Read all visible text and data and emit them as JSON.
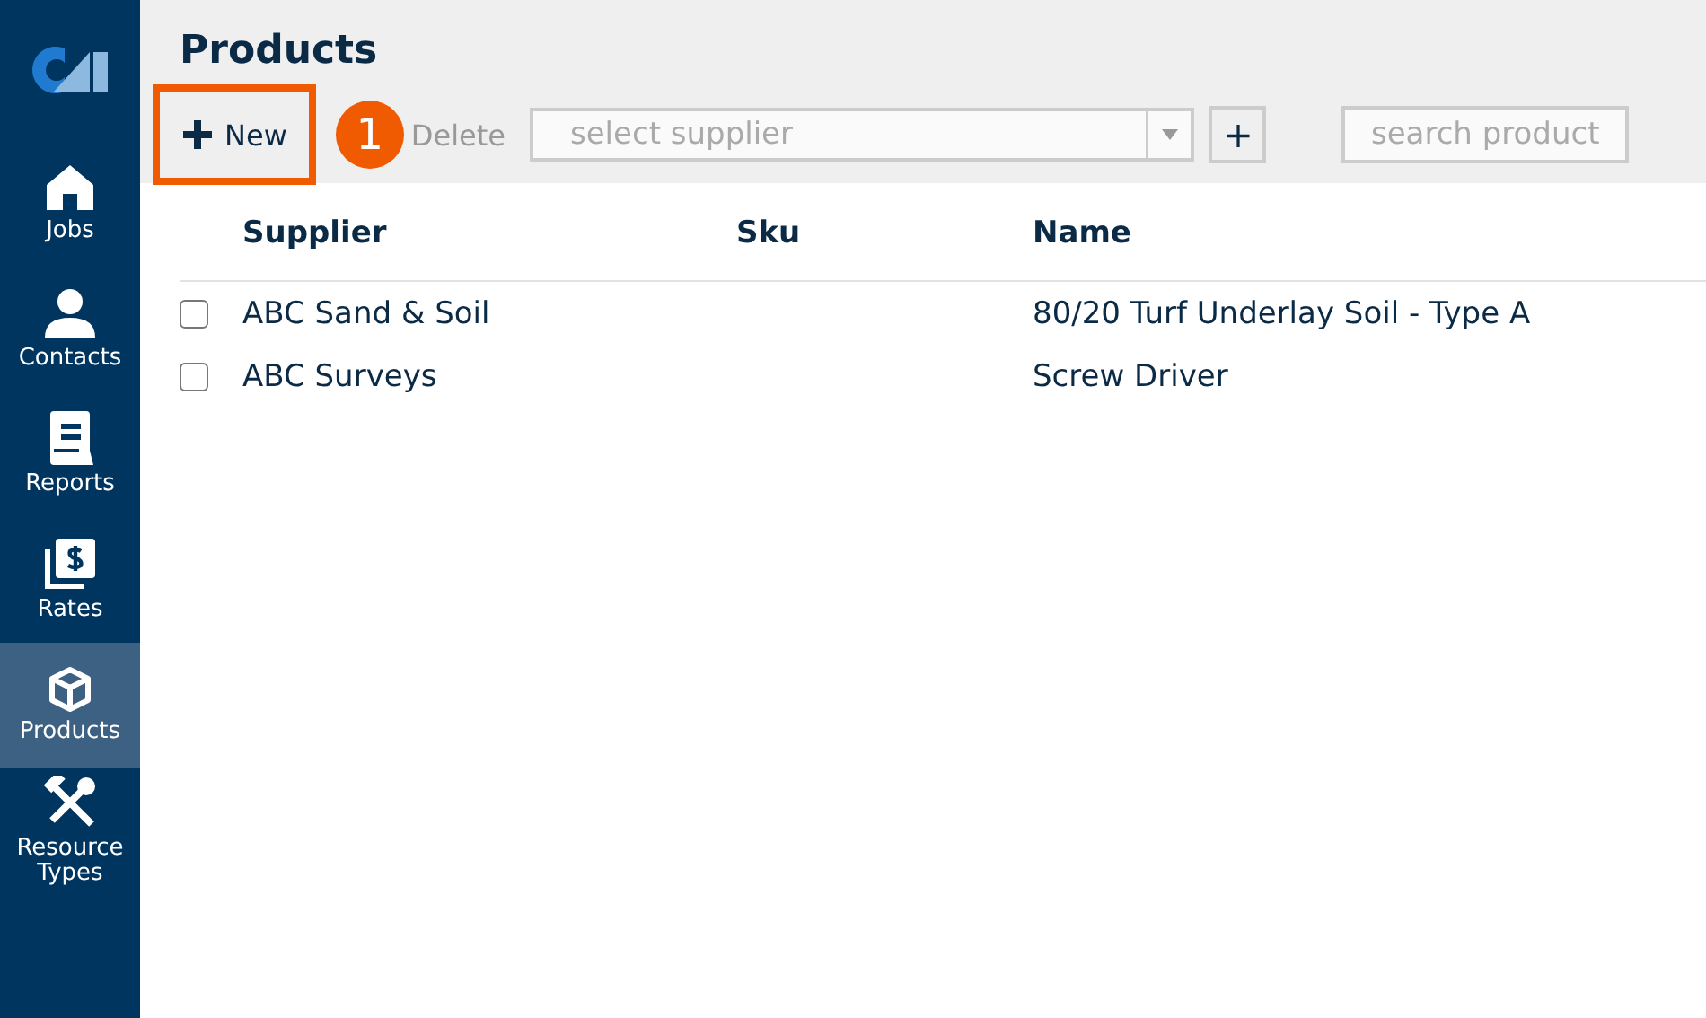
{
  "sidebar": {
    "items": [
      {
        "label": "Jobs",
        "selected": false
      },
      {
        "label": "Contacts",
        "selected": false
      },
      {
        "label": "Reports",
        "selected": false
      },
      {
        "label": "Rates",
        "selected": false
      },
      {
        "label": "Products",
        "selected": true
      },
      {
        "label": "Resource Types",
        "selected": false
      }
    ]
  },
  "page": {
    "title": "Products"
  },
  "toolbar": {
    "new_button": {
      "label": "New",
      "highlighted": true
    },
    "callout": "1",
    "delete_button": {
      "label": "Delete",
      "disabled": true
    },
    "supplier_select": {
      "placeholder": "select supplier"
    },
    "add_button": "+",
    "search": {
      "placeholder": "search product"
    }
  },
  "table": {
    "columns": [
      "Supplier",
      "Sku",
      "Name"
    ],
    "rows": [
      {
        "supplier": "ABC Sand & Soil",
        "name": "80/20 Turf Underlay Soil - Type A",
        "checked": false
      },
      {
        "supplier": "ABC Surveys",
        "name": "Screw Driver",
        "checked": false
      }
    ]
  }
}
